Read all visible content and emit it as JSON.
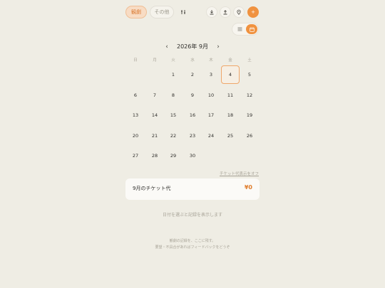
{
  "tabs": [
    {
      "label": "観劇",
      "active": true
    },
    {
      "label": "その他",
      "active": false
    }
  ],
  "toolbar": {
    "filter_icon": "filter-icon",
    "download_icon": "download-icon",
    "upload_icon": "upload-icon",
    "location_icon": "map-pin-icon",
    "add_icon": "plus-icon",
    "accent_color": "#f0923f"
  },
  "view_toggle": {
    "options": [
      {
        "icon": "list-icon",
        "selected": false
      },
      {
        "icon": "calendar-icon",
        "selected": true
      }
    ]
  },
  "calendar": {
    "prev": "‹",
    "next": "›",
    "month_label": "2026年 9月",
    "weekdays": [
      "日",
      "月",
      "火",
      "水",
      "木",
      "金",
      "土"
    ],
    "first_weekday": 2,
    "days_in_month": 30,
    "today": 4
  },
  "ticket": {
    "toggle_label": "チケット代表示をオフ",
    "label": "9月のチケット代",
    "amount": "¥0"
  },
  "hint": "日付を選ぶと記録を表示します",
  "footer": {
    "line1": "観劇の記録を、ここに残す。",
    "line2": "要望・不具合があればフィードバックをどうぞ"
  }
}
